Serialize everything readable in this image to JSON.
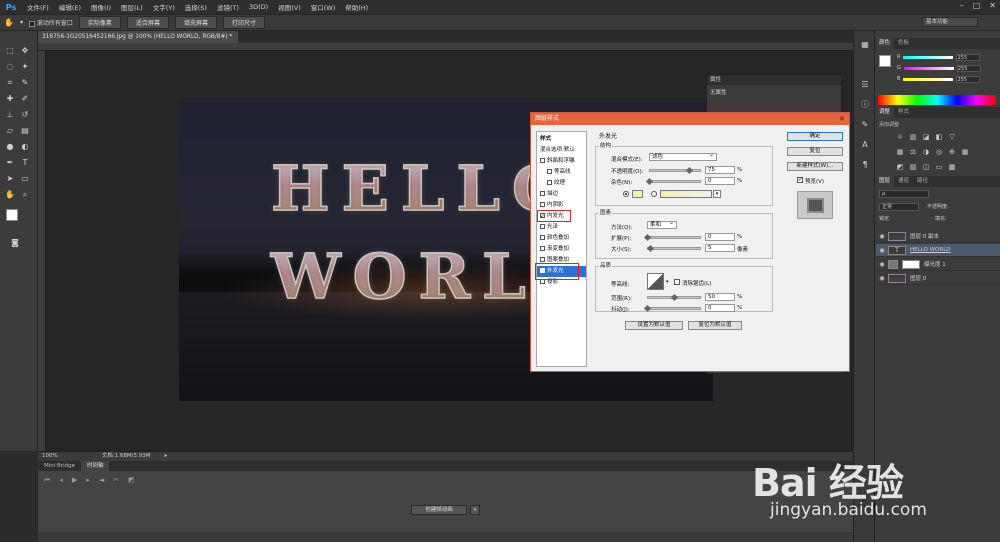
{
  "menubar": {
    "logo": "Ps",
    "items": [
      "文件(F)",
      "编辑(E)",
      "图像(I)",
      "图层(L)",
      "文字(Y)",
      "选择(S)",
      "滤镜(T)",
      "3D(D)",
      "视图(V)",
      "窗口(W)",
      "帮助(H)"
    ]
  },
  "optbar": {
    "scroll_all_label": "滚动所有窗口",
    "buttons": [
      "实际像素",
      "适合屏幕",
      "填充屏幕",
      "打印尺寸"
    ],
    "workspace": "基本功能"
  },
  "document": {
    "tab_title": "318756-1G20516452166.jpg @ 100% (HELLO WORLD, RGB/8#) *",
    "line1": "HELLO",
    "line2": "WORLD"
  },
  "statusbar": {
    "zoom": "100%",
    "doc_size": "文档:1.68M/3.93M"
  },
  "timeline": {
    "tabs": [
      "Mini Bridge",
      "时间轴"
    ],
    "create_button": "创建帧动画"
  },
  "properties": {
    "title": "属性",
    "subtitle": "无属性"
  },
  "color_panel": {
    "tabs": [
      "颜色",
      "色板"
    ],
    "channels": [
      {
        "label": "R",
        "value": "255"
      },
      {
        "label": "G",
        "value": "255"
      },
      {
        "label": "B",
        "value": "255"
      }
    ]
  },
  "adjust_panel": {
    "tabs": [
      "调整",
      "样式"
    ],
    "hint": "添加调整"
  },
  "layers_panel": {
    "tabs": [
      "图层",
      "通道",
      "路径"
    ],
    "blend_mode": "正常",
    "opacity_label": "不透明度:",
    "lock_label": "锁定:",
    "fill_label": "填充:",
    "layers": [
      {
        "name": "图层 0 副本",
        "type": "image"
      },
      {
        "name": "HELLO WORLD",
        "type": "text"
      },
      {
        "name": "曝光度 1",
        "type": "adjustment"
      },
      {
        "name": "图层 0",
        "type": "image"
      }
    ]
  },
  "dialog": {
    "title": "图层样式",
    "left_items": [
      {
        "label": "样式",
        "checkbox": false,
        "checked": false,
        "indent": 0
      },
      {
        "label": "混合选项:默认",
        "checkbox": false,
        "checked": false,
        "indent": 0
      },
      {
        "label": "斜面和浮雕",
        "checkbox": true,
        "checked": false,
        "indent": 0
      },
      {
        "label": "等高线",
        "checkbox": true,
        "checked": false,
        "indent": 1
      },
      {
        "label": "纹理",
        "checkbox": true,
        "checked": false,
        "indent": 1
      },
      {
        "label": "描边",
        "checkbox": true,
        "checked": false,
        "indent": 0
      },
      {
        "label": "内阴影",
        "checkbox": true,
        "checked": false,
        "indent": 0
      },
      {
        "label": "内发光",
        "checkbox": true,
        "checked": true,
        "indent": 0
      },
      {
        "label": "光泽",
        "checkbox": true,
        "checked": false,
        "indent": 0
      },
      {
        "label": "颜色叠加",
        "checkbox": true,
        "checked": false,
        "indent": 0
      },
      {
        "label": "渐变叠加",
        "checkbox": true,
        "checked": false,
        "indent": 0
      },
      {
        "label": "图案叠加",
        "checkbox": true,
        "checked": false,
        "indent": 0
      },
      {
        "label": "外发光",
        "checkbox": true,
        "checked": true,
        "indent": 0,
        "selected": true
      },
      {
        "label": "投影",
        "checkbox": true,
        "checked": false,
        "indent": 0
      }
    ],
    "section_title": "外发光",
    "structure": {
      "title": "结构",
      "blend_mode_label": "混合模式(E):",
      "blend_mode": "滤色",
      "opacity_label": "不透明度(O):",
      "opacity": "75",
      "noise_label": "杂色(N):",
      "noise": "0",
      "percent": "%"
    },
    "elements": {
      "title": "图素",
      "method_label": "方法(Q):",
      "method": "柔和",
      "spread_label": "扩展(P):",
      "spread": "0",
      "size_label": "大小(S):",
      "size": "5",
      "px": "像素",
      "percent": "%"
    },
    "quality": {
      "title": "品质",
      "contour_label": "等高线:",
      "antialias_label": "消除锯齿(L)",
      "range_label": "范围(R):",
      "range": "50",
      "jitter_label": "抖动(J):",
      "jitter": "0",
      "percent": "%"
    },
    "buttons": {
      "make_default": "设置为默认值",
      "reset_default": "复位为默认值",
      "ok": "确定",
      "reset": "复位",
      "new_style": "新建样式(W)...",
      "preview": "预览(V)"
    },
    "glow_color": "#f5efb0"
  },
  "watermark": {
    "brand": "Bai  经验",
    "url": "jingyan.baidu.com"
  }
}
